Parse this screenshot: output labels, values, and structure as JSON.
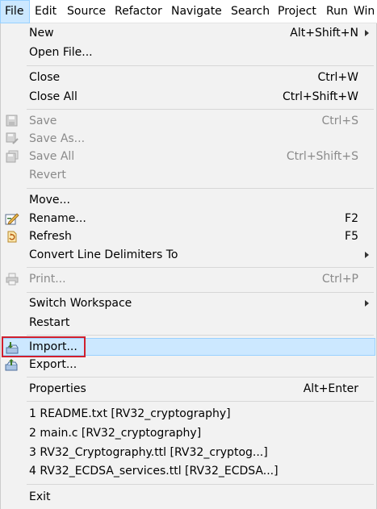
{
  "menubar": {
    "items": [
      "File",
      "Edit",
      "Source",
      "Refactor",
      "Navigate",
      "Search",
      "Project",
      "Run",
      "Win"
    ]
  },
  "menu": {
    "new": {
      "label": "New",
      "accel": "Alt+Shift+N"
    },
    "open_file": {
      "label": "Open File..."
    },
    "close": {
      "label": "Close",
      "accel": "Ctrl+W"
    },
    "close_all": {
      "label": "Close All",
      "accel": "Ctrl+Shift+W"
    },
    "save": {
      "label": "Save",
      "accel": "Ctrl+S"
    },
    "save_as": {
      "label": "Save As..."
    },
    "save_all": {
      "label": "Save All",
      "accel": "Ctrl+Shift+S"
    },
    "revert": {
      "label": "Revert"
    },
    "move": {
      "label": "Move..."
    },
    "rename": {
      "label": "Rename...",
      "accel": "F2"
    },
    "refresh": {
      "label": "Refresh",
      "accel": "F5"
    },
    "convert": {
      "label": "Convert Line Delimiters To"
    },
    "print": {
      "label": "Print...",
      "accel": "Ctrl+P"
    },
    "switch_workspace": {
      "label": "Switch Workspace"
    },
    "restart": {
      "label": "Restart"
    },
    "import": {
      "label": "Import..."
    },
    "export": {
      "label": "Export..."
    },
    "properties": {
      "label": "Properties",
      "accel": "Alt+Enter"
    },
    "recent": [
      "1 README.txt  [RV32_cryptography]",
      "2 main.c  [RV32_cryptography]",
      "3 RV32_Cryptography.ttl  [RV32_cryptog...]",
      "4 RV32_ECDSA_services.ttl  [RV32_ECDSA...]"
    ],
    "exit": {
      "label": "Exit"
    }
  },
  "icons": {
    "save": "save-icon",
    "save_as": "save-as-icon",
    "save_all": "save-all-icon",
    "rename": "rename-icon",
    "refresh": "refresh-icon",
    "print": "print-icon",
    "import": "import-icon",
    "export": "export-icon"
  },
  "colors": {
    "highlight": "#cce8ff",
    "highlight_border": "#99d1ff",
    "callout": "#d0202e",
    "disabled_text": "#8a8a8a"
  }
}
